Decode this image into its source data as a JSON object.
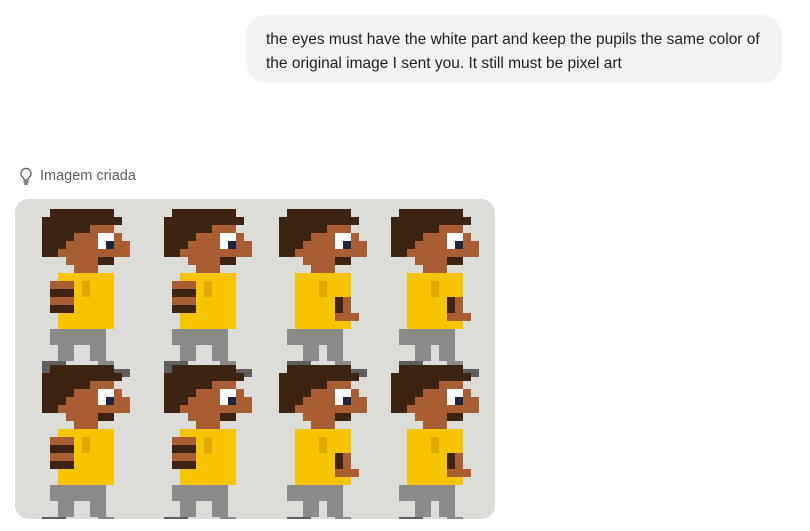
{
  "message": {
    "text": "the eyes must have the white part and keep the pupils the same color of the original image I sent you. It still must be pixel art"
  },
  "status": {
    "icon": "lightbulb-icon",
    "label": "Imagem criada"
  },
  "generated_image": {
    "rows": 2,
    "columns": 4,
    "colors": {
      "background": "#dcdcd8",
      "hair": "#3d2412",
      "skin": "#a85e32",
      "shirt": "#f6c400",
      "shirt_shade": "#e0a800",
      "pants": "#8a8a88",
      "shoes": "#5e5e5c",
      "eye_white": "#ffffff",
      "pupil": "#1e2540"
    }
  }
}
